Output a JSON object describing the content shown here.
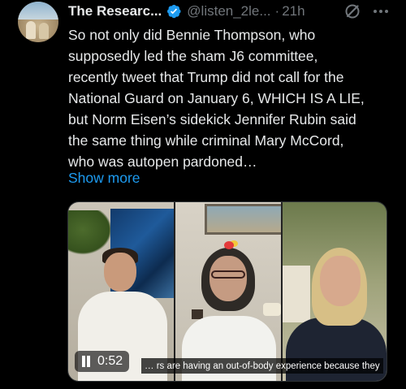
{
  "author": {
    "name": "The Researc...",
    "handle": "@listen_2le...",
    "separator": "·",
    "time": "21h",
    "verified_color": "#1d9bf0",
    "avatar_icon": "avatar-photo"
  },
  "header_icons": {
    "grok": "grok-icon",
    "more": "more-icon"
  },
  "body": {
    "lines": [
      "So not only did Bennie Thompson, who",
      "supposedly led the sham J6 committee,",
      "recently tweet that Trump did not call for the",
      "National Guard on January 6, WHICH IS A LIE,",
      "but Norm Eisen’s sidekick Jennifer Rubin said",
      "the same thing while criminal Mary McCord,",
      "who was autopen pardoned…"
    ],
    "show_more": "Show more"
  },
  "video": {
    "duration": "0:52",
    "caption": "… rs are having an out-of-body experience because they",
    "playback_state": "playing"
  },
  "colors": {
    "background": "#000000",
    "text": "#e7e9ea",
    "muted": "#71767b",
    "accent": "#1d9bf0"
  }
}
